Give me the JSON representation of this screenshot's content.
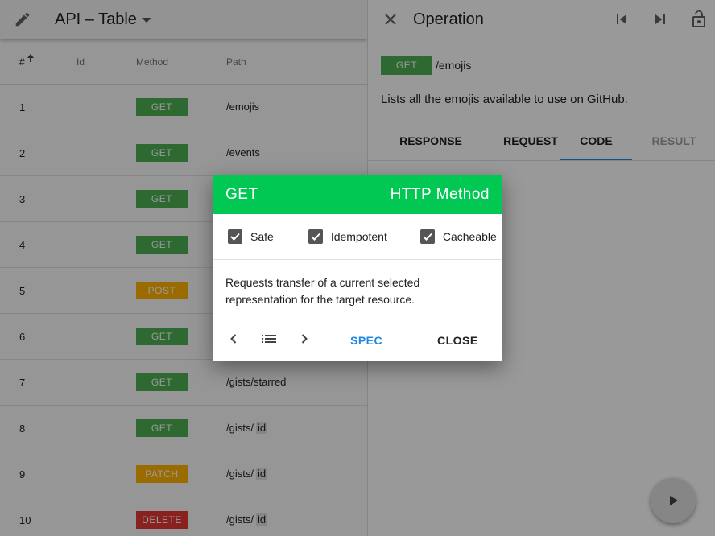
{
  "header": {
    "title": "API – Table"
  },
  "table": {
    "columns": [
      "#",
      "Id",
      "Method",
      "Path"
    ],
    "rows": [
      {
        "num": "1",
        "method": "GET",
        "path": "/emojis",
        "param": ""
      },
      {
        "num": "2",
        "method": "GET",
        "path": "/events",
        "param": ""
      },
      {
        "num": "3",
        "method": "GET",
        "path": "",
        "param": ""
      },
      {
        "num": "4",
        "method": "GET",
        "path": "",
        "param": ""
      },
      {
        "num": "5",
        "method": "POST",
        "path": "",
        "param": ""
      },
      {
        "num": "6",
        "method": "GET",
        "path": "",
        "param": ""
      },
      {
        "num": "7",
        "method": "GET",
        "path": "/gists/starred",
        "param": ""
      },
      {
        "num": "8",
        "method": "GET",
        "path": "/gists/",
        "param": "id"
      },
      {
        "num": "9",
        "method": "PATCH",
        "path": "/gists/",
        "param": "id"
      },
      {
        "num": "10",
        "method": "DELETE",
        "path": "/gists/",
        "param": "id"
      }
    ]
  },
  "colors": {
    "GET": "#4caf50",
    "POST": "#ffb300",
    "PATCH": "#ffb300",
    "DELETE": "#e53935",
    "accent": "#00c853"
  },
  "operation": {
    "title": "Operation",
    "method": "GET",
    "path": "/emojis",
    "description": "Lists all the emojis available to use on GitHub.",
    "tabs": [
      "RESPONSE",
      "REQUEST",
      "CODE",
      "RESULT"
    ],
    "active_tab": "CODE"
  },
  "dialog": {
    "method": "GET",
    "title": "HTTP Method",
    "checks": [
      "Safe",
      "Idempotent",
      "Cacheable"
    ],
    "description": "Requests transfer of a current selected representation for the target resource.",
    "spec_label": "SPEC",
    "close_label": "CLOSE"
  }
}
